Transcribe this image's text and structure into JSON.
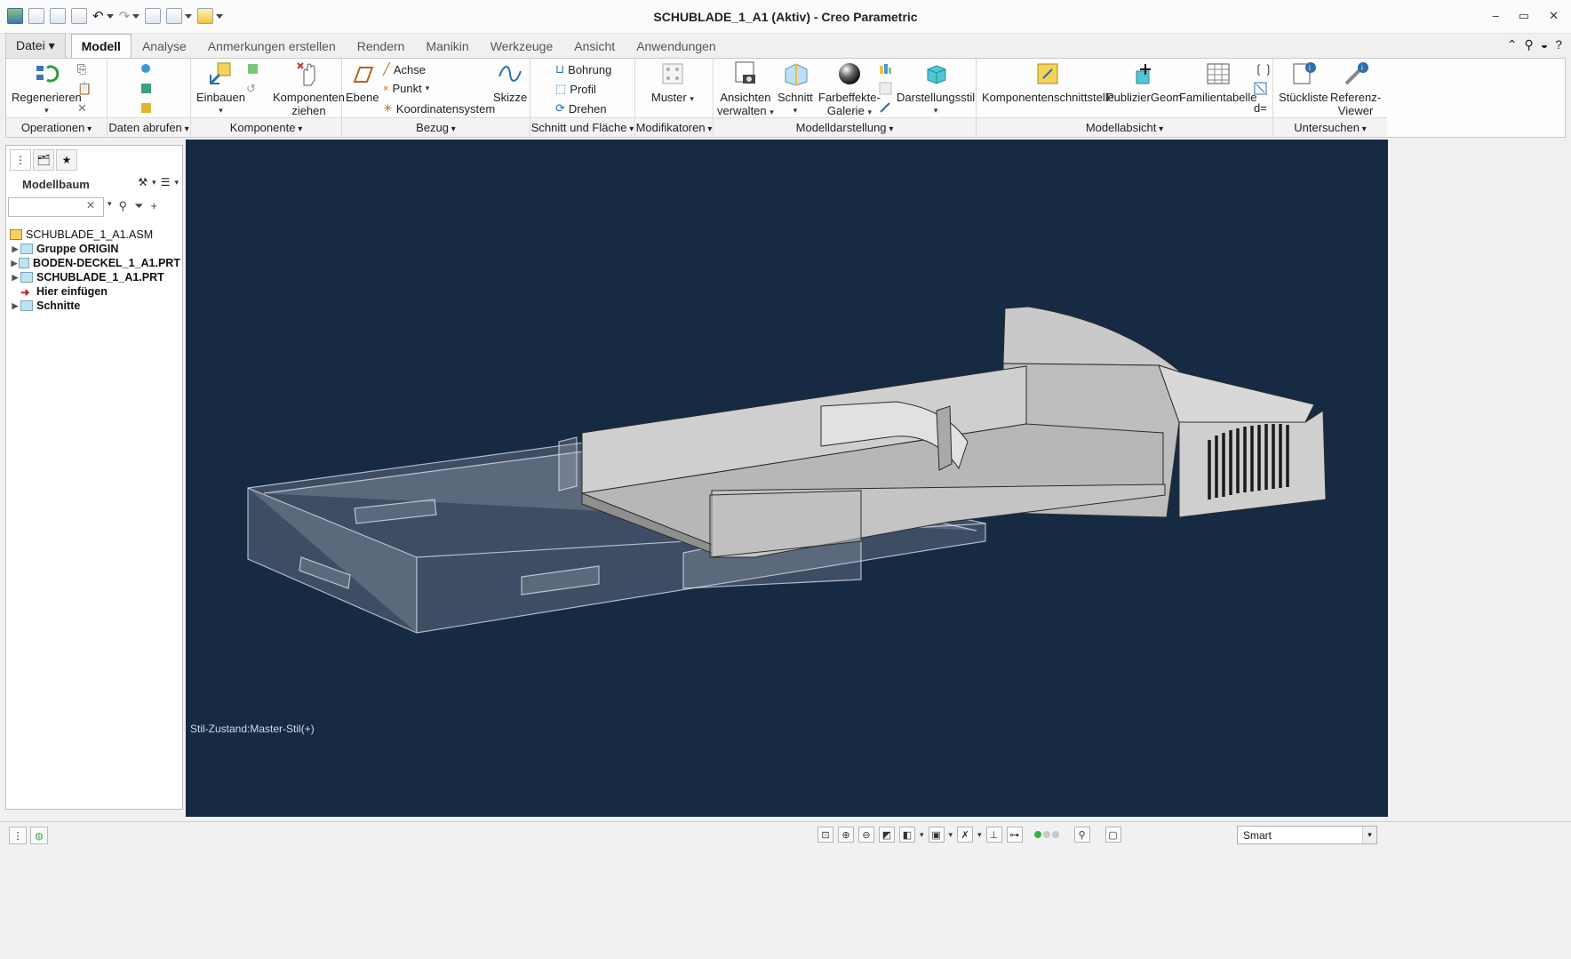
{
  "window": {
    "title": "SCHUBLADE_1_A1 (Aktiv) - Creo Parametric",
    "controls": [
      "–",
      "▭",
      "✕"
    ]
  },
  "tabs": [
    {
      "label": "Datei",
      "type": "file"
    },
    {
      "label": "Modell",
      "active": true
    },
    {
      "label": "Analyse"
    },
    {
      "label": "Anmerkungen erstellen"
    },
    {
      "label": "Rendern"
    },
    {
      "label": "Manikin"
    },
    {
      "label": "Werkzeuge"
    },
    {
      "label": "Ansicht"
    },
    {
      "label": "Anwendungen"
    }
  ],
  "ribbon": {
    "groups": {
      "operationen": "Operationen",
      "daten_abrufen": "Daten abrufen",
      "komponente": "Komponente",
      "bezug": "Bezug",
      "schnitt_flaeche": "Schnitt und Fläche",
      "modifikatoren": "Modifikatoren",
      "modelldarstellung": "Modelldarstellung",
      "modellabsicht": "Modellabsicht",
      "untersuchen": "Untersuchen"
    },
    "buttons": {
      "regenerieren": "Regenerieren",
      "einbauen": "Einbauen",
      "komponenten_ziehen_1": "Komponenten",
      "komponenten_ziehen_2": "ziehen",
      "ebene": "Ebene",
      "achse": "Achse",
      "punkt": "Punkt",
      "koordinatensystem": "Koordinatensystem",
      "skizze": "Skizze",
      "bohrung": "Bohrung",
      "profil": "Profil",
      "drehen": "Drehen",
      "muster": "Muster",
      "ansichten_1": "Ansichten",
      "ansichten_2": "verwalten",
      "schnitt": "Schnitt",
      "farbeffekte_1": "Farbeffekte-",
      "farbeffekte_2": "Galerie",
      "darstellungsstil": "Darstellungsstil",
      "komponentenschnittstelle": "Komponentenschnittstelle",
      "publiziergeom": "PublizierGeom",
      "familientabelle": "Familientabelle",
      "stueckliste": "Stückliste",
      "referenz_1": "Referenz-",
      "referenz_2": "Viewer",
      "d_equals": "d="
    }
  },
  "left_panel": {
    "header": "Modellbaum",
    "search_value": "",
    "tree": [
      {
        "label": "SCHUBLADE_1_A1.ASM",
        "expander": ""
      },
      {
        "label": "Gruppe ORIGIN",
        "expander": "▶"
      },
      {
        "label": "BODEN-DECKEL_1_A1.PRT",
        "expander": "▶"
      },
      {
        "label": "SCHUBLADE_1_A1.PRT",
        "expander": "▶"
      },
      {
        "label": "Hier einfügen",
        "expander": ""
      },
      {
        "label": "Schnitte",
        "expander": "▶"
      }
    ]
  },
  "viewport": {
    "style_state": "Stil-Zustand:Master-Stil(+)",
    "background": "#172a44"
  },
  "statusbar": {
    "selection_filter": "Smart"
  },
  "colors": {
    "accent": "#2f6ea8",
    "viewport_bg": "#172a44",
    "light_green": "#2fb34a",
    "light_grey": "#c8c8c8"
  }
}
